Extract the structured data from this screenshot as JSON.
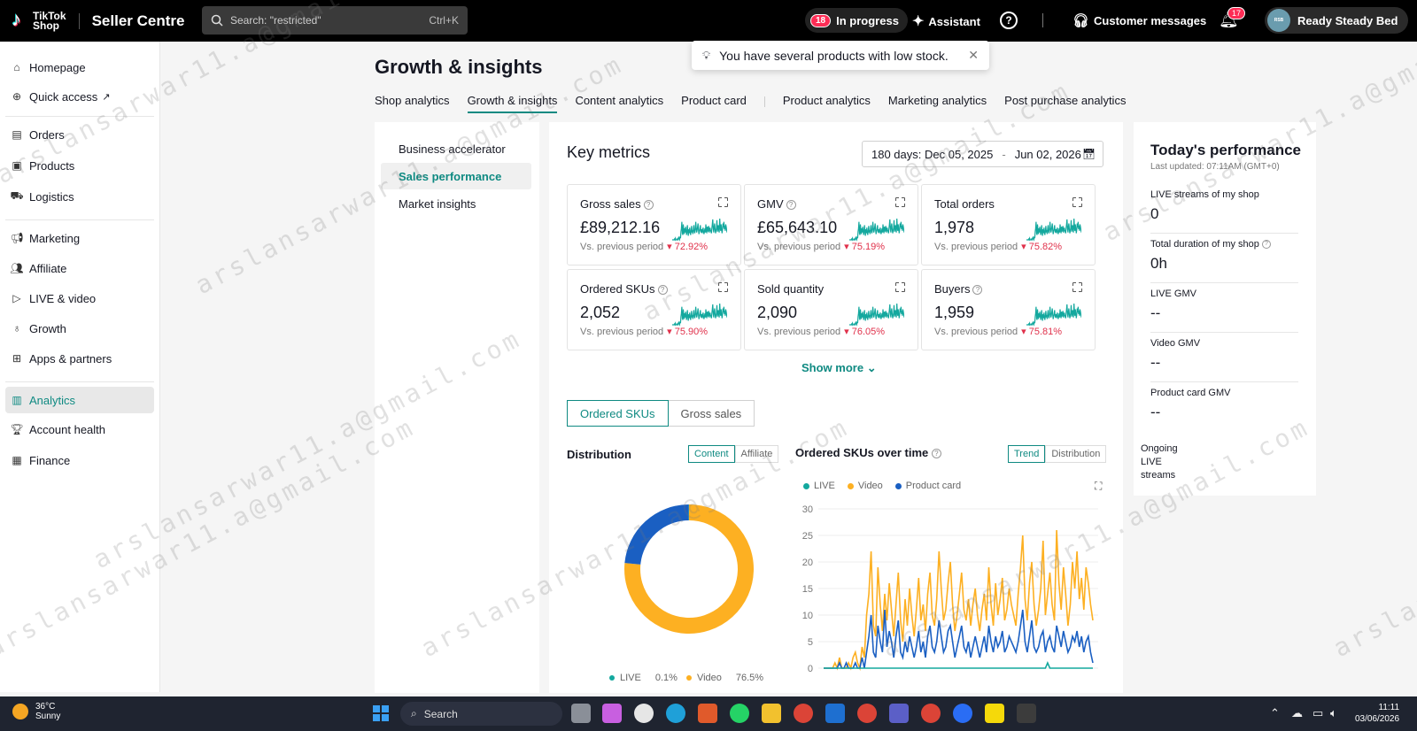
{
  "header": {
    "logo_text_1": "TikTok",
    "logo_text_2": "Shop",
    "product_name": "Seller Centre",
    "search_placeholder": "Search: \"restricted\"",
    "search_shortcut": "Ctrl+K",
    "in_progress_count": "18",
    "in_progress_label": "In progress",
    "assistant_label": "Assistant",
    "customer_messages_label": "Customer messages",
    "notifications_count": "17",
    "account_name": "Ready Steady Bed"
  },
  "toast": {
    "message": "You have several products with low stock."
  },
  "sidebar": {
    "items": [
      {
        "label": "Homepage",
        "icon": "home-icon"
      },
      {
        "label": "Quick access",
        "icon": "plus-circle-icon"
      },
      {
        "label": "Orders",
        "icon": "clipboard-icon"
      },
      {
        "label": "Products",
        "icon": "box-icon"
      },
      {
        "label": "Logistics",
        "icon": "truck-icon"
      },
      {
        "label": "Marketing",
        "icon": "megaphone-icon"
      },
      {
        "label": "Affiliate",
        "icon": "users-icon"
      },
      {
        "label": "LIVE & video",
        "icon": "live-icon"
      },
      {
        "label": "Growth",
        "icon": "medal-icon"
      },
      {
        "label": "Apps & partners",
        "icon": "apps-icon"
      },
      {
        "label": "Analytics",
        "icon": "bar-chart-icon"
      },
      {
        "label": "Account health",
        "icon": "trophy-icon"
      },
      {
        "label": "Finance",
        "icon": "wallet-icon"
      }
    ],
    "active": "Analytics"
  },
  "page": {
    "title": "Growth & insights",
    "tabs": [
      "Shop analytics",
      "Growth & insights",
      "Content analytics",
      "Product card",
      "Product analytics",
      "Marketing analytics",
      "Post purchase analytics"
    ],
    "active_tab": "Growth & insights"
  },
  "subnav": {
    "items": [
      "Business accelerator",
      "Sales performance",
      "Market insights"
    ],
    "active": "Sales performance"
  },
  "key_metrics": {
    "title": "Key metrics",
    "date_prefix": "180 days:",
    "date_start": "Dec 05, 2025",
    "date_sep": "-",
    "date_end": "Jun 02, 2026",
    "comparison_label": "Vs. previous period",
    "cards": [
      {
        "title": "Gross sales",
        "value": "£89,212.16",
        "change": "72.92%",
        "info": true
      },
      {
        "title": "GMV",
        "value": "£65,643.10",
        "change": "75.19%",
        "info": true
      },
      {
        "title": "Total orders",
        "value": "1,978",
        "change": "75.82%",
        "info": false
      },
      {
        "title": "Ordered SKUs",
        "value": "2,052",
        "change": "75.90%",
        "info": true
      },
      {
        "title": "Sold quantity",
        "value": "2,090",
        "change": "76.05%",
        "info": false
      },
      {
        "title": "Buyers",
        "value": "1,959",
        "change": "75.81%",
        "info": true
      }
    ],
    "show_more": "Show more"
  },
  "metric_toggle": {
    "selected": "Ordered SKUs",
    "other": "Gross sales"
  },
  "distribution": {
    "title": "Distribution",
    "toggle_on": "Content",
    "toggle_off": "Affiliate",
    "legend": [
      {
        "name": "LIVE",
        "pct": "0.1%"
      },
      {
        "name": "Video",
        "pct": "76.5%"
      }
    ]
  },
  "over_time": {
    "title": "Ordered SKUs over time",
    "toggle_on": "Trend",
    "toggle_off": "Distribution",
    "legend": [
      "LIVE",
      "Video",
      "Product card"
    ]
  },
  "chart_data": [
    {
      "type": "pie",
      "title": "Distribution",
      "categories": [
        "LIVE",
        "Video",
        "Product card"
      ],
      "values": [
        0.1,
        76.5,
        23.4
      ],
      "colors": [
        "#13a89e",
        "#fdb022",
        "#1a5fc2"
      ]
    },
    {
      "type": "line",
      "title": "Ordered SKUs over time",
      "ylim": [
        0,
        30
      ],
      "yticks": [
        0,
        5,
        10,
        15,
        20,
        25,
        30
      ],
      "series": [
        {
          "name": "LIVE",
          "color": "#13a89e",
          "values": [
            0,
            0,
            0,
            0,
            0,
            0,
            0,
            0,
            0,
            0,
            0,
            0,
            0,
            0,
            0,
            0,
            0,
            0,
            0,
            0,
            0,
            0,
            0,
            0,
            0,
            0,
            0,
            0,
            0,
            0,
            0,
            0,
            0,
            0,
            0,
            0,
            0,
            0,
            0,
            0,
            0,
            0,
            0,
            0,
            0,
            0,
            0,
            0,
            0,
            0,
            0,
            0,
            0,
            0,
            0,
            0,
            0,
            0,
            0,
            0,
            0,
            0,
            0,
            0,
            0,
            0,
            0,
            0,
            0,
            0,
            0,
            0,
            0,
            0,
            0,
            0,
            0,
            0,
            0,
            0,
            0,
            0,
            0,
            0,
            0,
            0,
            0,
            0,
            0,
            0,
            0,
            0,
            0,
            0,
            0,
            0,
            0,
            0,
            0,
            1,
            0,
            0,
            0,
            0,
            0,
            0,
            0,
            0,
            0,
            0,
            0,
            0,
            0,
            0,
            0,
            0,
            0,
            0,
            0,
            0
          ]
        },
        {
          "name": "Video",
          "color": "#fdb022",
          "values": [
            0,
            0,
            0,
            0,
            0,
            1,
            0,
            2,
            0,
            0,
            0,
            1,
            0,
            2,
            3,
            1,
            0,
            4,
            2,
            10,
            14,
            22,
            8,
            6,
            19,
            12,
            7,
            14,
            9,
            16,
            11,
            6,
            12,
            18,
            9,
            5,
            13,
            8,
            15,
            10,
            6,
            11,
            17,
            9,
            12,
            7,
            14,
            18,
            10,
            8,
            13,
            22,
            15,
            9,
            11,
            16,
            20,
            12,
            7,
            10,
            14,
            18,
            11,
            9,
            13,
            8,
            12,
            15,
            10,
            7,
            11,
            14,
            9,
            19,
            12,
            8,
            16,
            10,
            13,
            17,
            9,
            11,
            15,
            12,
            10,
            8,
            14,
            19,
            25,
            13,
            9,
            16,
            20,
            12,
            8,
            11,
            15,
            24,
            10,
            14,
            18,
            12,
            9,
            26,
            16,
            11,
            19,
            14,
            8,
            12,
            20,
            15,
            22,
            13,
            17,
            11,
            19,
            16,
            12,
            9
          ]
        },
        {
          "name": "Product card",
          "color": "#1a5fc2",
          "values": [
            0,
            0,
            0,
            0,
            0,
            0,
            0,
            1,
            0,
            0,
            1,
            0,
            0,
            0,
            1,
            0,
            0,
            2,
            0,
            3,
            6,
            10,
            3,
            2,
            8,
            5,
            3,
            11,
            4,
            7,
            5,
            2,
            6,
            9,
            3,
            2,
            5,
            3,
            6,
            4,
            2,
            4,
            7,
            3,
            5,
            2,
            6,
            8,
            4,
            3,
            5,
            9,
            6,
            3,
            4,
            7,
            8,
            5,
            2,
            4,
            6,
            8,
            4,
            3,
            5,
            2,
            4,
            6,
            4,
            2,
            4,
            6,
            3,
            8,
            5,
            3,
            6,
            4,
            5,
            7,
            3,
            4,
            6,
            5,
            4,
            3,
            5,
            8,
            11,
            5,
            3,
            6,
            9,
            4,
            3,
            4,
            6,
            7,
            3,
            5,
            6,
            4,
            3,
            8,
            6,
            4,
            7,
            5,
            3,
            4,
            6,
            5,
            7,
            4,
            6,
            3,
            5,
            6,
            3,
            1
          ]
        }
      ]
    }
  ],
  "today": {
    "title": "Today's performance",
    "updated": "Last updated: 07:11AM (GMT+0)",
    "metrics": [
      {
        "label": "LIVE streams of my shop",
        "value": "0"
      },
      {
        "label": "Total duration of my shop",
        "value": "0h"
      },
      {
        "label": "LIVE GMV",
        "value": "--"
      },
      {
        "label": "Video GMV",
        "value": "--"
      },
      {
        "label": "Product card GMV",
        "value": "--"
      }
    ],
    "ongoing": "Ongoing LIVE streams"
  },
  "watermark": "arslansarwar11.a@gmail.com",
  "taskbar": {
    "weather_temp": "36°C",
    "weather_desc": "Sunny",
    "search_label": "Search",
    "time": "11:11",
    "date": "03/06/2026"
  }
}
